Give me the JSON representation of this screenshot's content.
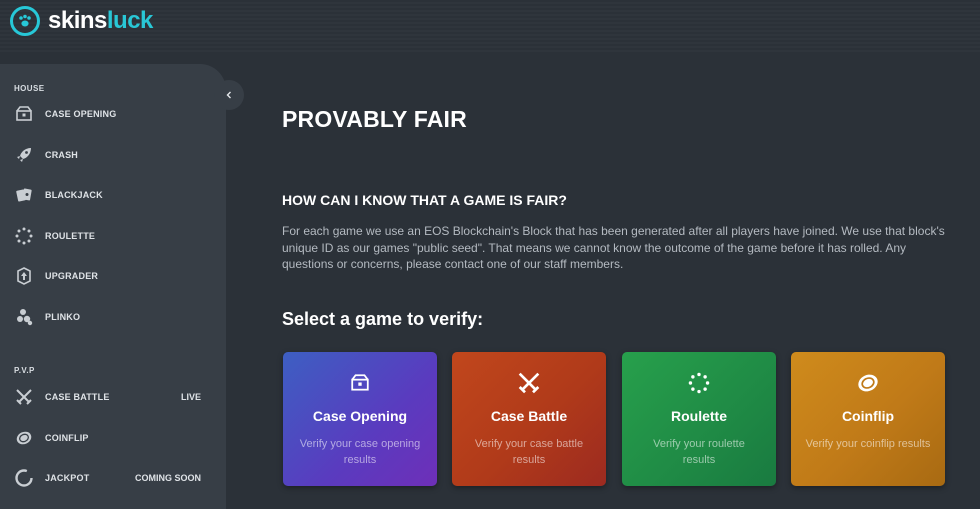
{
  "brand": {
    "name_a": "skins",
    "name_b": "luck"
  },
  "sidebar": {
    "sections": [
      {
        "title": "HOUSE"
      },
      {
        "title": "P.V.P"
      }
    ],
    "house_items": [
      {
        "label": "CASE OPENING",
        "icon": "case-icon"
      },
      {
        "label": "CRASH",
        "icon": "rocket-icon"
      },
      {
        "label": "BLACKJACK",
        "icon": "cards-icon"
      },
      {
        "label": "ROULETTE",
        "icon": "roulette-icon"
      },
      {
        "label": "UPGRADER",
        "icon": "upgrade-icon"
      },
      {
        "label": "PLINKO",
        "icon": "plinko-icon"
      }
    ],
    "pvp_items": [
      {
        "label": "CASE BATTLE",
        "tag": "LIVE",
        "icon": "swords-icon"
      },
      {
        "label": "COINFLIP",
        "tag": "",
        "icon": "coin-icon"
      },
      {
        "label": "JACKPOT",
        "tag": "COMING SOON",
        "icon": "jackpot-icon"
      }
    ]
  },
  "main": {
    "title": "PROVABLY FAIR",
    "question": "HOW CAN I KNOW THAT A GAME IS FAIR?",
    "paragraph": "For each game we use an EOS Blockchain's Block that has been generated after all players have joined. We use that block's unique ID as our games \"public seed\". That means we cannot know the outcome of the game before it has rolled. Any questions or concerns, please contact one of our staff members.",
    "select_heading": "Select a game to verify:",
    "cards": [
      {
        "title": "Case Opening",
        "desc": "Verify your case opening results",
        "icon": "case-icon"
      },
      {
        "title": "Case Battle",
        "desc": "Verify your case battle results",
        "icon": "swords-icon"
      },
      {
        "title": "Roulette",
        "desc": "Verify your roulette results",
        "icon": "roulette-icon"
      },
      {
        "title": "Coinflip",
        "desc": "Verify your coinflip results",
        "icon": "coin-icon"
      }
    ]
  },
  "colors": {
    "accent": "#29c7d6",
    "background": "#2b3138",
    "sidebar": "#373e46"
  }
}
